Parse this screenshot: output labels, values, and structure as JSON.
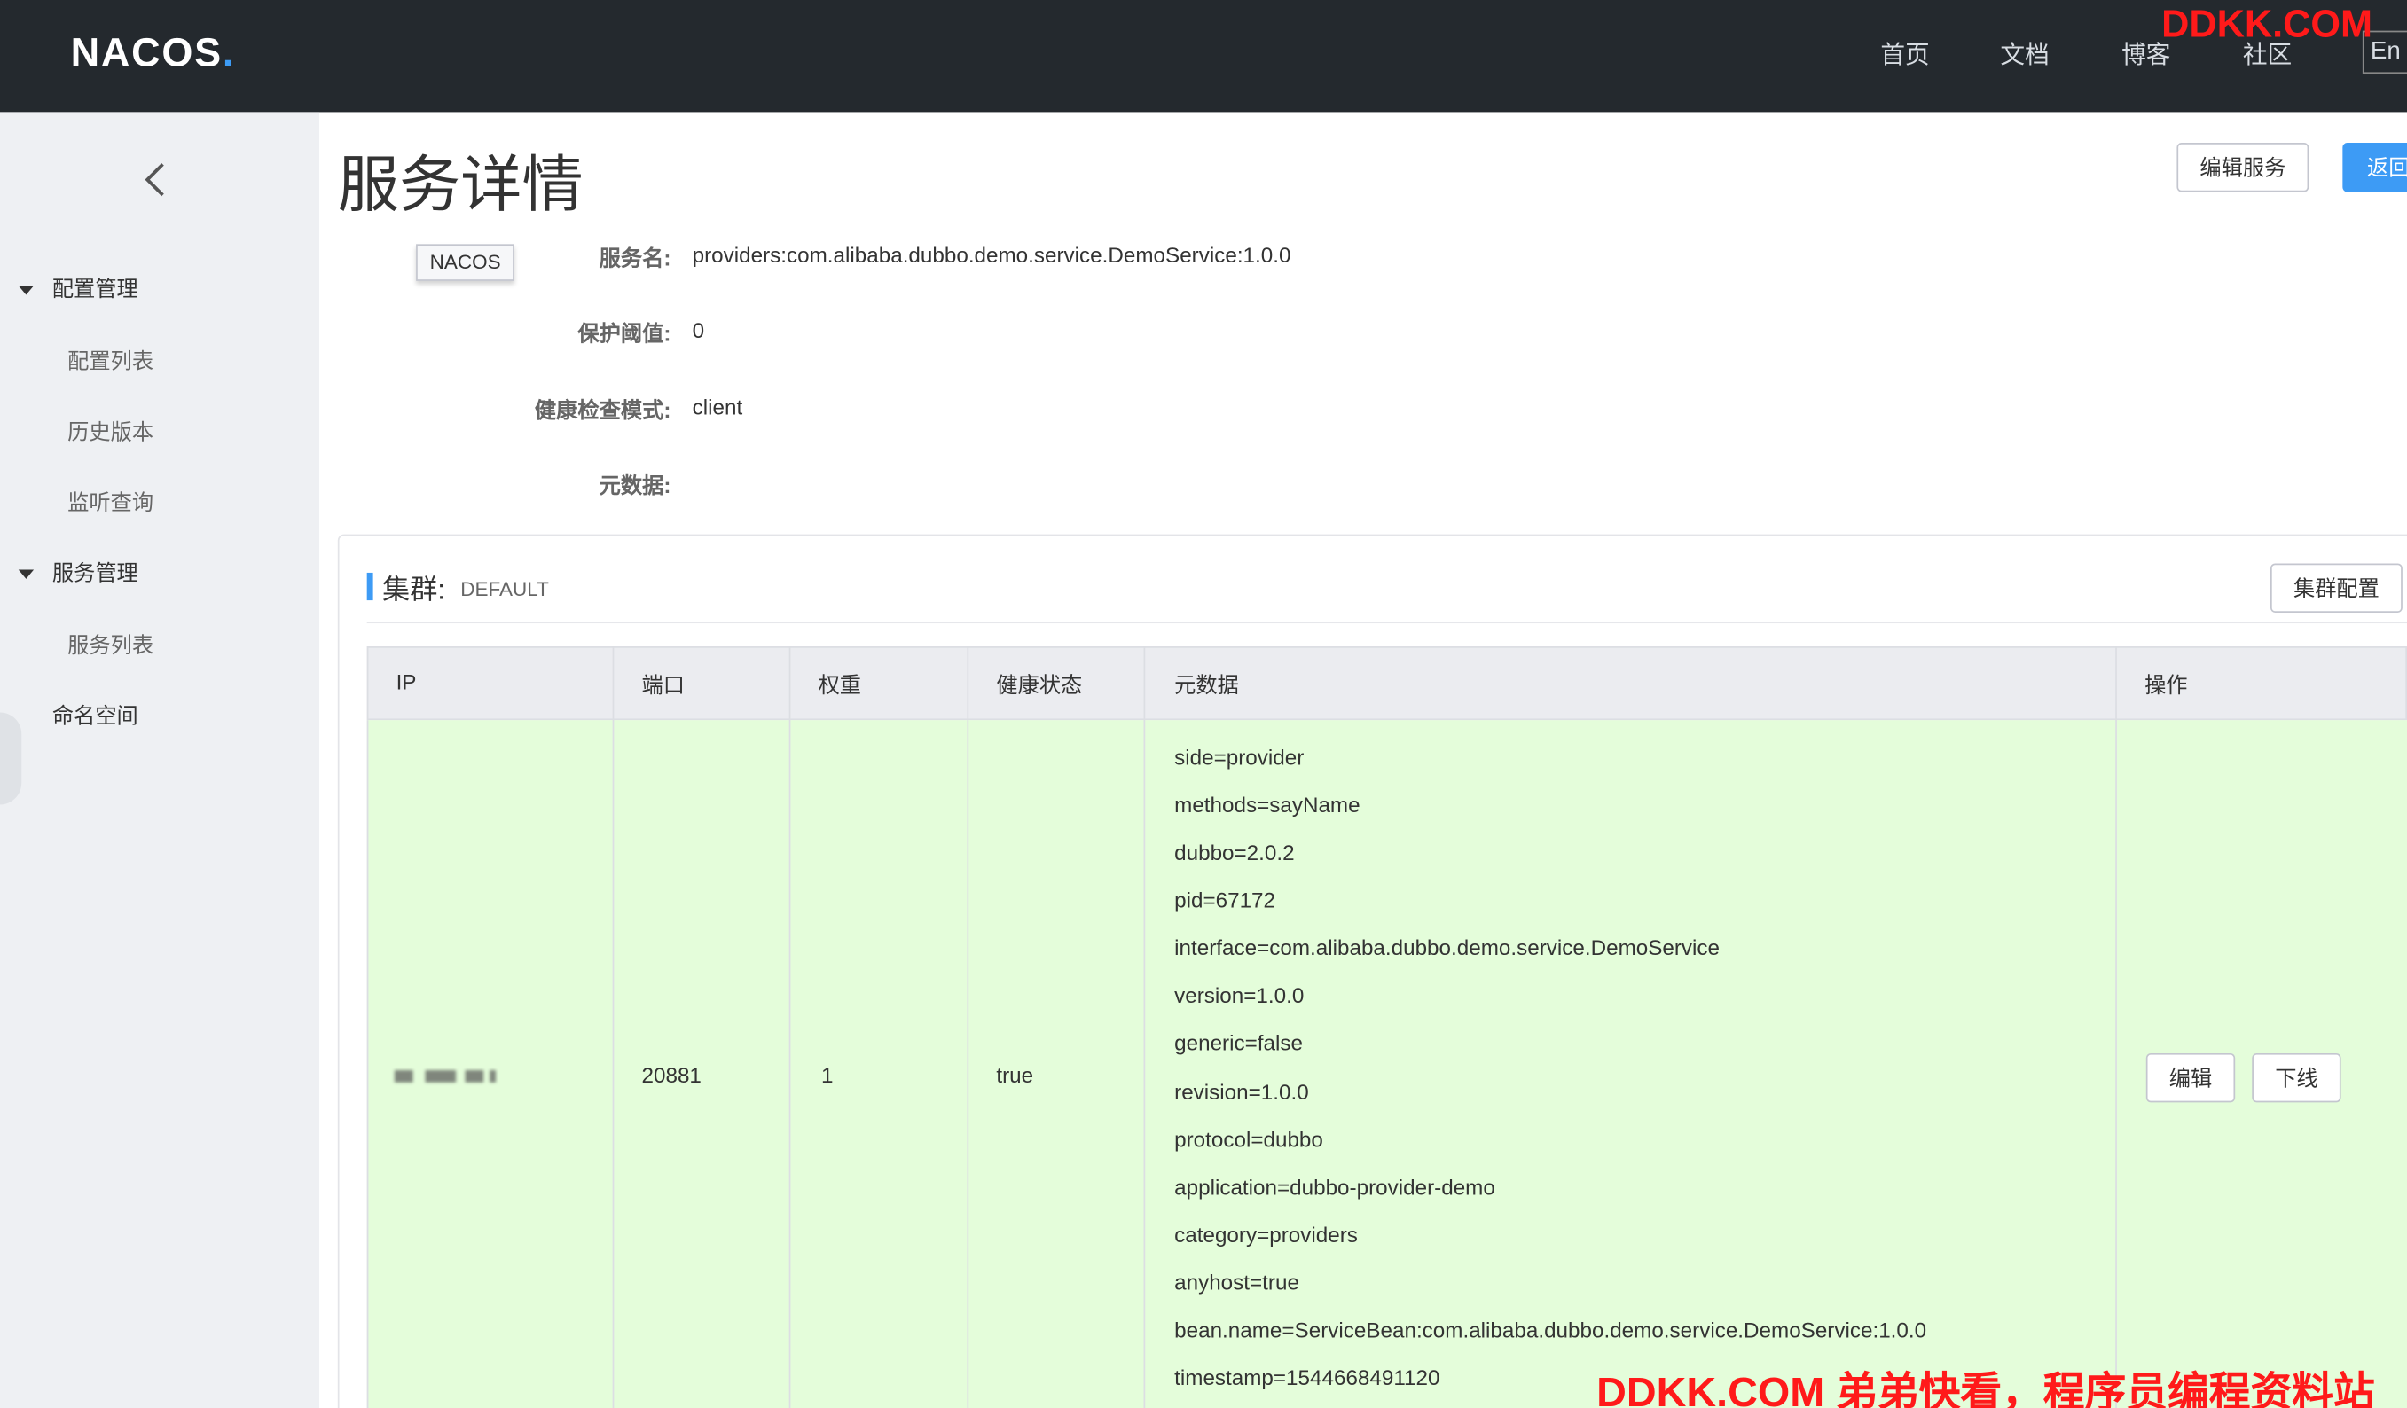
{
  "header": {
    "logo_main": "NAC",
    "logo_mid": "OS",
    "logo_dot": ".",
    "nav": [
      "首页",
      "文档",
      "博客",
      "社区"
    ],
    "lang": "En",
    "watermark_top": "DDKK.COM"
  },
  "sidebar": {
    "groups": [
      {
        "label": "配置管理",
        "items": [
          "配置列表",
          "历史版本",
          "监听查询"
        ]
      },
      {
        "label": "服务管理",
        "items": [
          "服务列表"
        ]
      }
    ],
    "namespace": "命名空间"
  },
  "page": {
    "title": "服务详情",
    "edit_service": "编辑服务",
    "back": "返回",
    "tooltip": "NACOS"
  },
  "form": {
    "service_name_label": "服务名:",
    "service_name": "providers:com.alibaba.dubbo.demo.service.DemoService:1.0.0",
    "threshold_label": "保护阈值:",
    "threshold": "0",
    "health_mode_label": "健康检查模式:",
    "health_mode": "client",
    "metadata_label": "元数据:"
  },
  "cluster": {
    "label": "集群:",
    "name": "DEFAULT",
    "config_button": "集群配置",
    "columns": [
      "IP",
      "端口",
      "权重",
      "健康状态",
      "元数据",
      "操作"
    ],
    "row": {
      "port": "20881",
      "weight": "1",
      "healthy": "true",
      "metadata": [
        "side=provider",
        "methods=sayName",
        "dubbo=2.0.2",
        "pid=67172",
        "interface=com.alibaba.dubbo.demo.service.DemoService",
        "version=1.0.0",
        "generic=false",
        "revision=1.0.0",
        "protocol=dubbo",
        "application=dubbo-provider-demo",
        "category=providers",
        "anyhost=true",
        "bean.name=ServiceBean:com.alibaba.dubbo.demo.service.DemoService:1.0.0",
        "timestamp=1544668491120"
      ],
      "edit": "编辑",
      "offline": "下线"
    }
  },
  "watermark_bottom": "DDKK.COM 弟弟快看，程序员编程资料站"
}
